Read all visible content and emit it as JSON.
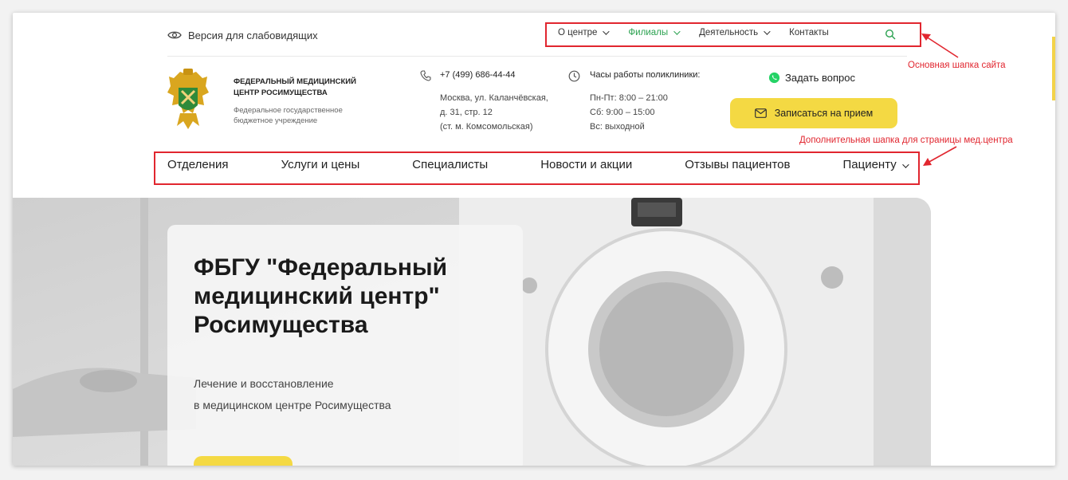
{
  "top_bar": {
    "low_vision_label": "Версия для слабовидящих",
    "nav": [
      {
        "label": "О центре",
        "has_dropdown": true,
        "active": false
      },
      {
        "label": "Филиалы",
        "has_dropdown": true,
        "active": true
      },
      {
        "label": "Деятельность",
        "has_dropdown": true,
        "active": false
      },
      {
        "label": "Контакты",
        "has_dropdown": false,
        "active": false
      }
    ],
    "active_color": "#2aa14f"
  },
  "org": {
    "name": "Федеральный медицинский центр Росимущества",
    "subtitle": "Федеральное государственное бюджетное учреждение"
  },
  "contacts": {
    "phone": "+7 (499) 686-44-44",
    "address": [
      "Москва, ул. Каланчёвская,",
      "д. 31, стр. 12",
      "(ст. м. Комсомольская)"
    ]
  },
  "hours": {
    "title": "Часы работы поликлиники:",
    "lines": [
      "Пн-Пт: 8:00 – 21:00",
      "Сб: 9:00 – 15:00",
      "Вс: выходной"
    ]
  },
  "actions": {
    "ask_label": "Задать вопрос",
    "book_label": "Записаться на прием",
    "accent_color": "#f4d943"
  },
  "annotations": {
    "main_header": "Основная шапка сайта",
    "secondary_header": "Дополнительная шапка для страницы мед.центра",
    "color": "#e1262f"
  },
  "secondary_nav": [
    {
      "label": "Отделения",
      "has_dropdown": false
    },
    {
      "label": "Услуги и цены",
      "has_dropdown": false
    },
    {
      "label": "Специалисты",
      "has_dropdown": false
    },
    {
      "label": "Новости и акции",
      "has_dropdown": false
    },
    {
      "label": "Отзывы пациентов",
      "has_dropdown": false
    },
    {
      "label": "Пациенту",
      "has_dropdown": true
    }
  ],
  "hero": {
    "title": "ФБГУ \"Федеральный медицинский центр\" Росимущества",
    "subtitle_lines": [
      "Лечение и восстановление",
      "в медицинском центре Росимущества"
    ]
  }
}
